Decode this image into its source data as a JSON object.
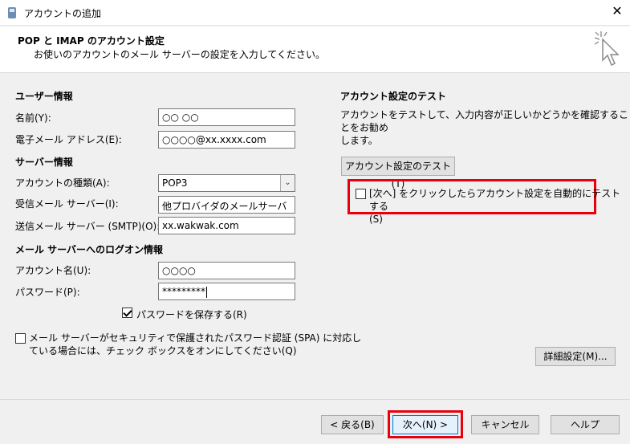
{
  "window": {
    "title": "アカウントの追加",
    "close_glyph": "✕"
  },
  "header": {
    "title": "POP と IMAP のアカウント設定",
    "subtitle": "お使いのアカウントのメール サーバーの設定を入力してください。"
  },
  "user_info": {
    "section": "ユーザー情報",
    "name_label": "名前(Y):",
    "name_value": "○○ ○○",
    "email_label": "電子メール アドレス(E):",
    "email_value": "○○○○@xx.xxxx.com"
  },
  "server_info": {
    "section": "サーバー情報",
    "account_type_label": "アカウントの種類(A):",
    "account_type_value": "POP3",
    "incoming_label": "受信メール サーバー(I):",
    "incoming_value": "他プロバイダのメールサーバ",
    "outgoing_label": "送信メール サーバー (SMTP)(O):",
    "outgoing_value": "xx.wakwak.com"
  },
  "logon_info": {
    "section": "メール サーバーへのログオン情報",
    "account_name_label": "アカウント名(U):",
    "account_name_value": "○○○○",
    "password_label": "パスワード(P):",
    "password_value": "*********",
    "save_password_label": "パスワードを保存する(R)",
    "save_password_checked": true,
    "spa_label_line1": "メール サーバーがセキュリティで保護されたパスワード認証 (SPA) に対応し",
    "spa_label_line2": "ている場合には、チェック ボックスをオンにしてください(Q)",
    "spa_checked": false
  },
  "test": {
    "section": "アカウント設定のテスト",
    "description_line1": "アカウントをテストして、入力内容が正しいかどうかを確認することをお勧め",
    "description_line2": "します。",
    "test_button": "アカウント設定のテスト(T)",
    "auto_test_line1": "[次へ] をクリックしたらアカウント設定を自動的にテストする",
    "auto_test_line2": "(S)",
    "auto_test_checked": false
  },
  "buttons": {
    "advanced": "詳細設定(M)...",
    "back": "< 戻る(B)",
    "next": "次へ(N) >",
    "cancel": "キャンセル",
    "help": "ヘルプ"
  },
  "colors": {
    "highlight": "#e8000b",
    "accent": "#0078d7"
  }
}
